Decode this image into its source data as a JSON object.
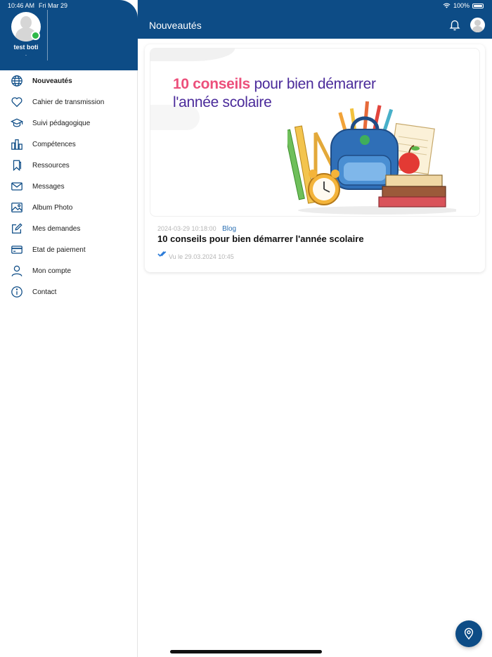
{
  "status_bar": {
    "time": "10:46 AM",
    "date": "Fri Mar 29",
    "battery": "100%"
  },
  "user": {
    "name": "test boti",
    "subtitle": "."
  },
  "sidebar": {
    "items": [
      {
        "label": "Nouveautés",
        "icon": "globe-icon",
        "active": true
      },
      {
        "label": "Cahier de transmission",
        "icon": "heart-icon"
      },
      {
        "label": "Suivi pédagogique",
        "icon": "graduation-cap-icon"
      },
      {
        "label": "Compétences",
        "icon": "bar-chart-icon"
      },
      {
        "label": "Ressources",
        "icon": "bookmark-icon"
      },
      {
        "label": "Messages",
        "icon": "envelope-icon"
      },
      {
        "label": "Album Photo",
        "icon": "image-icon"
      },
      {
        "label": "Mes demandes",
        "icon": "edit-icon"
      },
      {
        "label": "Etat de paiement",
        "icon": "credit-card-icon"
      },
      {
        "label": "Mon compte",
        "icon": "user-icon"
      },
      {
        "label": "Contact",
        "icon": "info-icon"
      }
    ]
  },
  "header": {
    "title": "Nouveautés"
  },
  "post": {
    "image_headline_highlight": "10 conseils",
    "image_headline_rest": " pour bien démarrer",
    "image_headline_line2": "l'année scolaire",
    "date": "2024-03-29 10:18:00",
    "category": "Blog",
    "title": "10 conseils pour bien démarrer l'année scolaire",
    "seen": "Vu le 29.03.2024 10:45"
  },
  "colors": {
    "primary": "#0d4c86",
    "accent_pink": "#ec4f7b",
    "online": "#2fb84a",
    "link": "#2a6fb3"
  }
}
